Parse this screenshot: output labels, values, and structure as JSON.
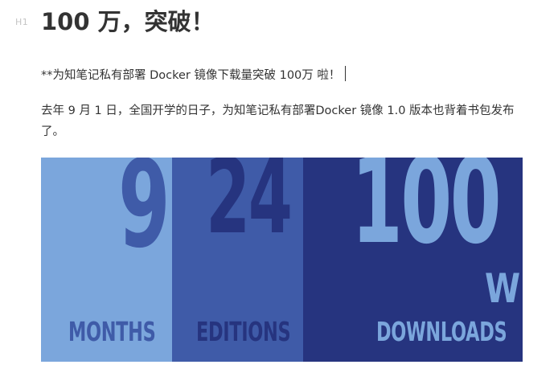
{
  "document": {
    "heading_level": "H1",
    "heading": "100 万，突破！",
    "paragraph1": "**为知笔记私有部署 Docker 镜像下载量突破 100万 啦！",
    "paragraph2": "去年 9 月 1 日，全国开学的日子，为知笔记私有部署Docker 镜像 1.0 版本也背着书包发布了。"
  },
  "banner": {
    "panels": [
      {
        "number": "9",
        "label": "MONTHS"
      },
      {
        "number": "24",
        "label": "EDITIONS"
      },
      {
        "number": "100",
        "unit": "W",
        "label": "DOWNLOADS"
      }
    ],
    "colors": {
      "light": "#7ba6dc",
      "mid": "#3f5ba8",
      "dark": "#26347f"
    }
  }
}
